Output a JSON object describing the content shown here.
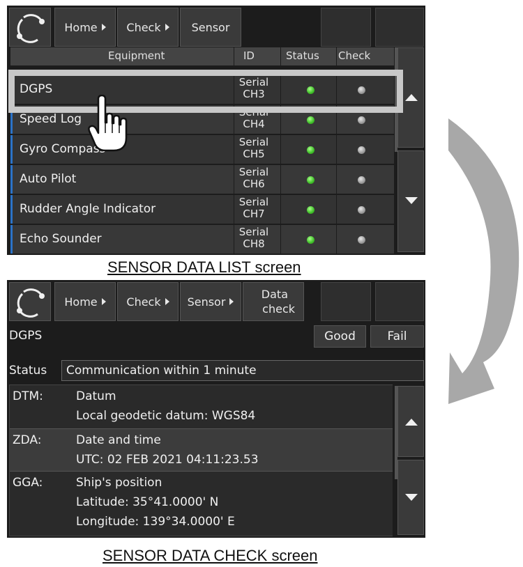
{
  "list_screen": {
    "breadcrumb": {
      "home": "Home",
      "check": "Check",
      "sensor": "Sensor"
    },
    "columns": {
      "equipment": "Equipment",
      "id": "ID",
      "status": "Status",
      "check": "Check"
    },
    "rows": [
      {
        "name": "DGPS",
        "serial_top": "Serial",
        "serial_bottom": "CH3"
      },
      {
        "name": "Speed Log",
        "serial_top": "Serial",
        "serial_bottom": "CH4"
      },
      {
        "name": "Gyro Compass",
        "serial_top": "Serial",
        "serial_bottom": "CH5"
      },
      {
        "name": "Auto Pilot",
        "serial_top": "Serial",
        "serial_bottom": "CH6"
      },
      {
        "name": "Rudder Angle Indicator",
        "serial_top": "Serial",
        "serial_bottom": "CH7"
      },
      {
        "name": "Echo Sounder",
        "serial_top": "Serial",
        "serial_bottom": "CH8"
      }
    ],
    "caption": "SENSOR DATA LIST screen"
  },
  "check_screen": {
    "breadcrumb": {
      "home": "Home",
      "check": "Check",
      "sensor": "Sensor",
      "data_top": "Data",
      "data_bottom": "check"
    },
    "equipment": "DGPS",
    "good_label": "Good",
    "fail_label": "Fail",
    "status_label": "Status",
    "status_value": "Communication within 1 minute",
    "sentences": [
      {
        "code": "DTM:",
        "lines": [
          "Datum",
          "Local geodetic datum: WGS84"
        ]
      },
      {
        "code": "ZDA:",
        "lines": [
          "Date and time",
          "UTC: 02 FEB 2021 04:11:23.53"
        ]
      },
      {
        "code": "GGA:",
        "lines": [
          "Ship's position",
          "Latitude: 35°41.0000' N",
          "Longitude: 139°34.0000' E"
        ]
      }
    ],
    "caption": "SENSOR DATA CHECK screen"
  },
  "colors": {
    "accent_bar": "#2b73c8",
    "status_ok": "#3fbf28",
    "check_idle": "#9a9a9a",
    "highlight": "#c8c8c8"
  }
}
